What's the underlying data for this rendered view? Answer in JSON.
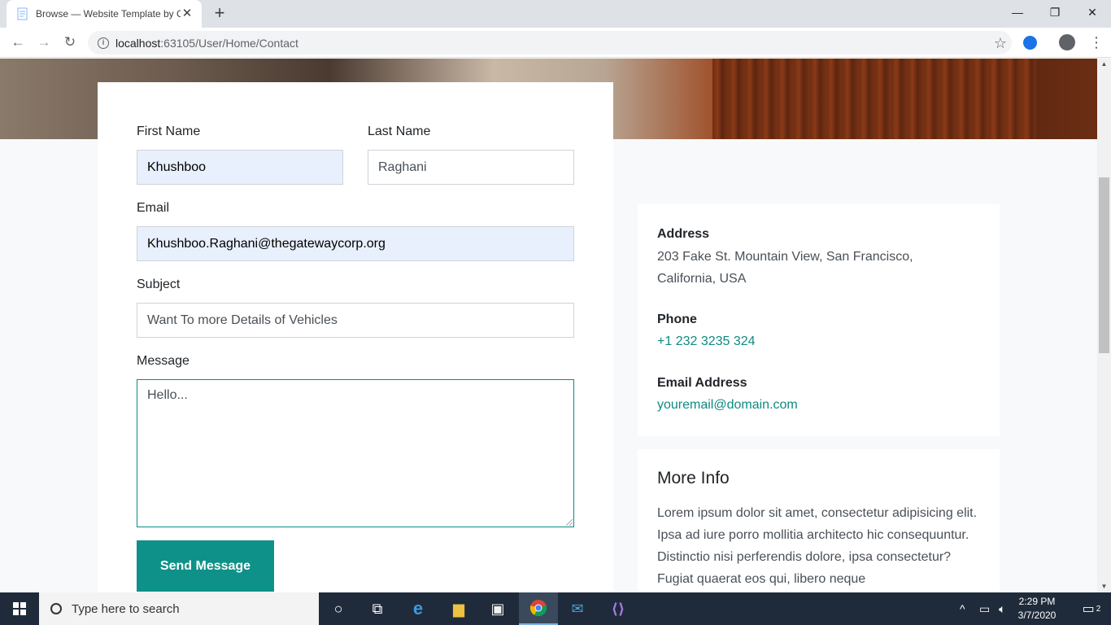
{
  "browser": {
    "tab_title": "Browse — Website Template by C",
    "url_host": "localhost",
    "url_path": ":63105/User/Home/Contact"
  },
  "form": {
    "first_name_label": "First Name",
    "first_name_value": "Khushboo",
    "last_name_label": "Last Name",
    "last_name_value": "Raghani",
    "email_label": "Email",
    "email_value": "Khushboo.Raghani@thegatewaycorp.org",
    "subject_label": "Subject",
    "subject_value": "Want To more Details of Vehicles",
    "message_label": "Message",
    "message_value": "Hello...",
    "send_label": "Send Message"
  },
  "contact": {
    "address_label": "Address",
    "address_value": "203 Fake St. Mountain View, San Francisco, California, USA",
    "phone_label": "Phone",
    "phone_value": "+1 232 3235 324",
    "email_label": "Email Address",
    "email_value": "youremail@domain.com"
  },
  "more_info": {
    "title": "More Info",
    "text": "Lorem ipsum dolor sit amet, consectetur adipisicing elit. Ipsa ad iure porro mollitia architecto hic consequuntur. Distinctio nisi perferendis dolore, ipsa consectetur? Fugiat quaerat eos qui, libero neque"
  },
  "taskbar": {
    "search_placeholder": "Type here to search",
    "time": "2:29 PM",
    "date": "3/7/2020",
    "notification_count": "2"
  },
  "colors": {
    "accent": "#0e9188",
    "link": "#0e8a83",
    "autofill": "#e8f0fe"
  }
}
